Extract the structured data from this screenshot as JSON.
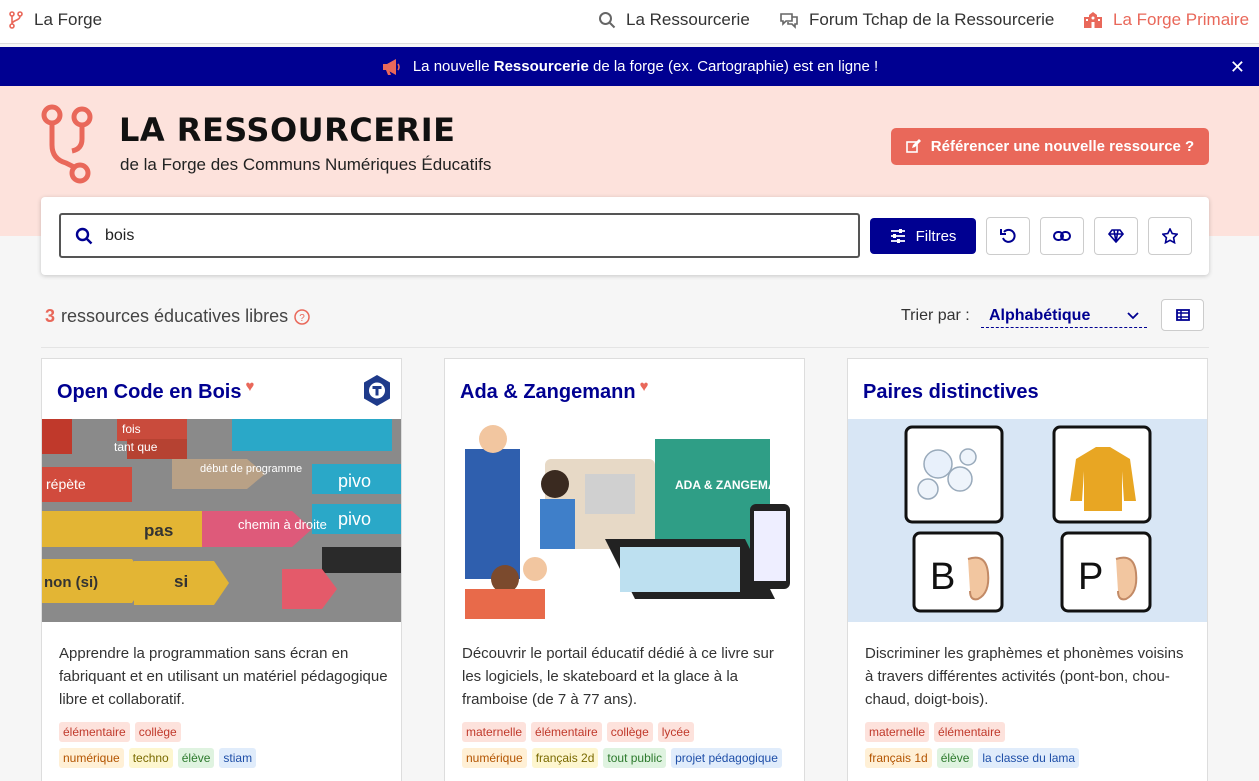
{
  "nav": {
    "brand": "La Forge",
    "links": [
      {
        "label": "La Ressourcerie",
        "icon": "search-icon"
      },
      {
        "label": "Forum Tchap de la Ressourcerie",
        "icon": "chat-icon"
      },
      {
        "label": "La Forge Primaire",
        "icon": "school-icon"
      }
    ]
  },
  "banner": {
    "text_before": "La nouvelle ",
    "text_bold": "Ressourcerie",
    "text_after": " de la forge (ex. Cartographie) est en ligne !",
    "close": "✕"
  },
  "header": {
    "title": "LA RESSOURCERIE",
    "subtitle": "de la Forge des Communs Numériques Éducatifs",
    "cta": "Référencer une nouvelle ressource ?"
  },
  "search": {
    "value": "bois",
    "filters_label": "Filtres"
  },
  "results": {
    "count": "3",
    "count_label": "ressources éducatives libres",
    "sort_label": "Trier par :",
    "sort_value": "Alphabétique"
  },
  "cards": [
    {
      "title": "Open Code en Bois",
      "favorite": true,
      "description": "Apprendre la programmation sans écran en fabriquant et en utilisant un matériel pédagogique libre et collaboratif.",
      "tags_row1": [
        "élémentaire",
        "collège"
      ],
      "tags_row2": [
        "numérique",
        "techno",
        "élève",
        "stiam"
      ],
      "image_words": [
        "fois",
        "tant que",
        "répète",
        "début de programme",
        "pivo",
        "pivo",
        "pas",
        "chemin à droite",
        "non (si)",
        "si"
      ]
    },
    {
      "title": "Ada & Zangemann",
      "favorite": true,
      "description": "Découvrir le portail éducatif dédié à ce livre sur les logiciels, le skateboard et la glace à la framboise (de 7 à 77 ans).",
      "tags_row1": [
        "maternelle",
        "élémentaire",
        "collège",
        "lycée"
      ],
      "tags_row2": [
        "numérique",
        "français 2d",
        "tout public",
        "projet pédagogique"
      ],
      "image_words": [
        "ADA & ZANGEMANN"
      ]
    },
    {
      "title": "Paires distinctives",
      "favorite": false,
      "description": "Discriminer les graphèmes et phonèmes voisins à travers différentes activités (pont-bon, chou-chaud, doigt-bois).",
      "tags_row1": [
        "maternelle",
        "élémentaire"
      ],
      "tags_row2": [
        "français 1d",
        "élève",
        "la classe du lama"
      ],
      "image_words": [
        "B",
        "P"
      ]
    }
  ],
  "colors": {
    "primary": "#000091",
    "accent": "#e9685a",
    "hero_bg": "#fde2dc"
  }
}
